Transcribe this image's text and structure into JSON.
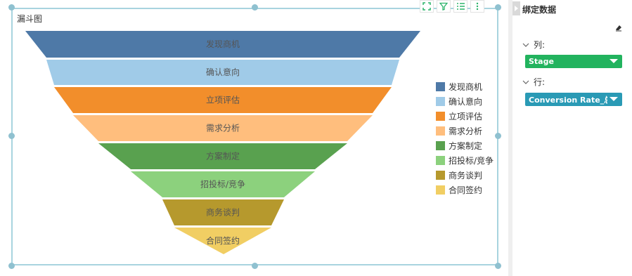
{
  "widget": {
    "title": "漏斗图"
  },
  "toolbar": {
    "icons": [
      "fullscreen-icon",
      "filter-icon",
      "list-icon",
      "more-vertical-icon"
    ]
  },
  "chart_data": {
    "type": "funnel",
    "stages": [
      {
        "label": "发现商机",
        "color": "#4e79a7"
      },
      {
        "label": "确认意向",
        "color": "#a0cbe8"
      },
      {
        "label": "立项评估",
        "color": "#f28e2b"
      },
      {
        "label": "需求分析",
        "color": "#ffbe7d"
      },
      {
        "label": "方案制定",
        "color": "#59a14f"
      },
      {
        "label": "招投标/竞争",
        "color": "#8cd17d"
      },
      {
        "label": "商务谈判",
        "color": "#b6992d"
      },
      {
        "label": "合同签约",
        "color": "#f1ce63"
      }
    ]
  },
  "panel": {
    "title": "绑定数据",
    "columns_label": "列:",
    "columns_field": "Stage",
    "columns_color": "#22b35e",
    "rows_label": "行:",
    "rows_field": "Conversion Rate_总...",
    "rows_color": "#2a9ab5"
  }
}
